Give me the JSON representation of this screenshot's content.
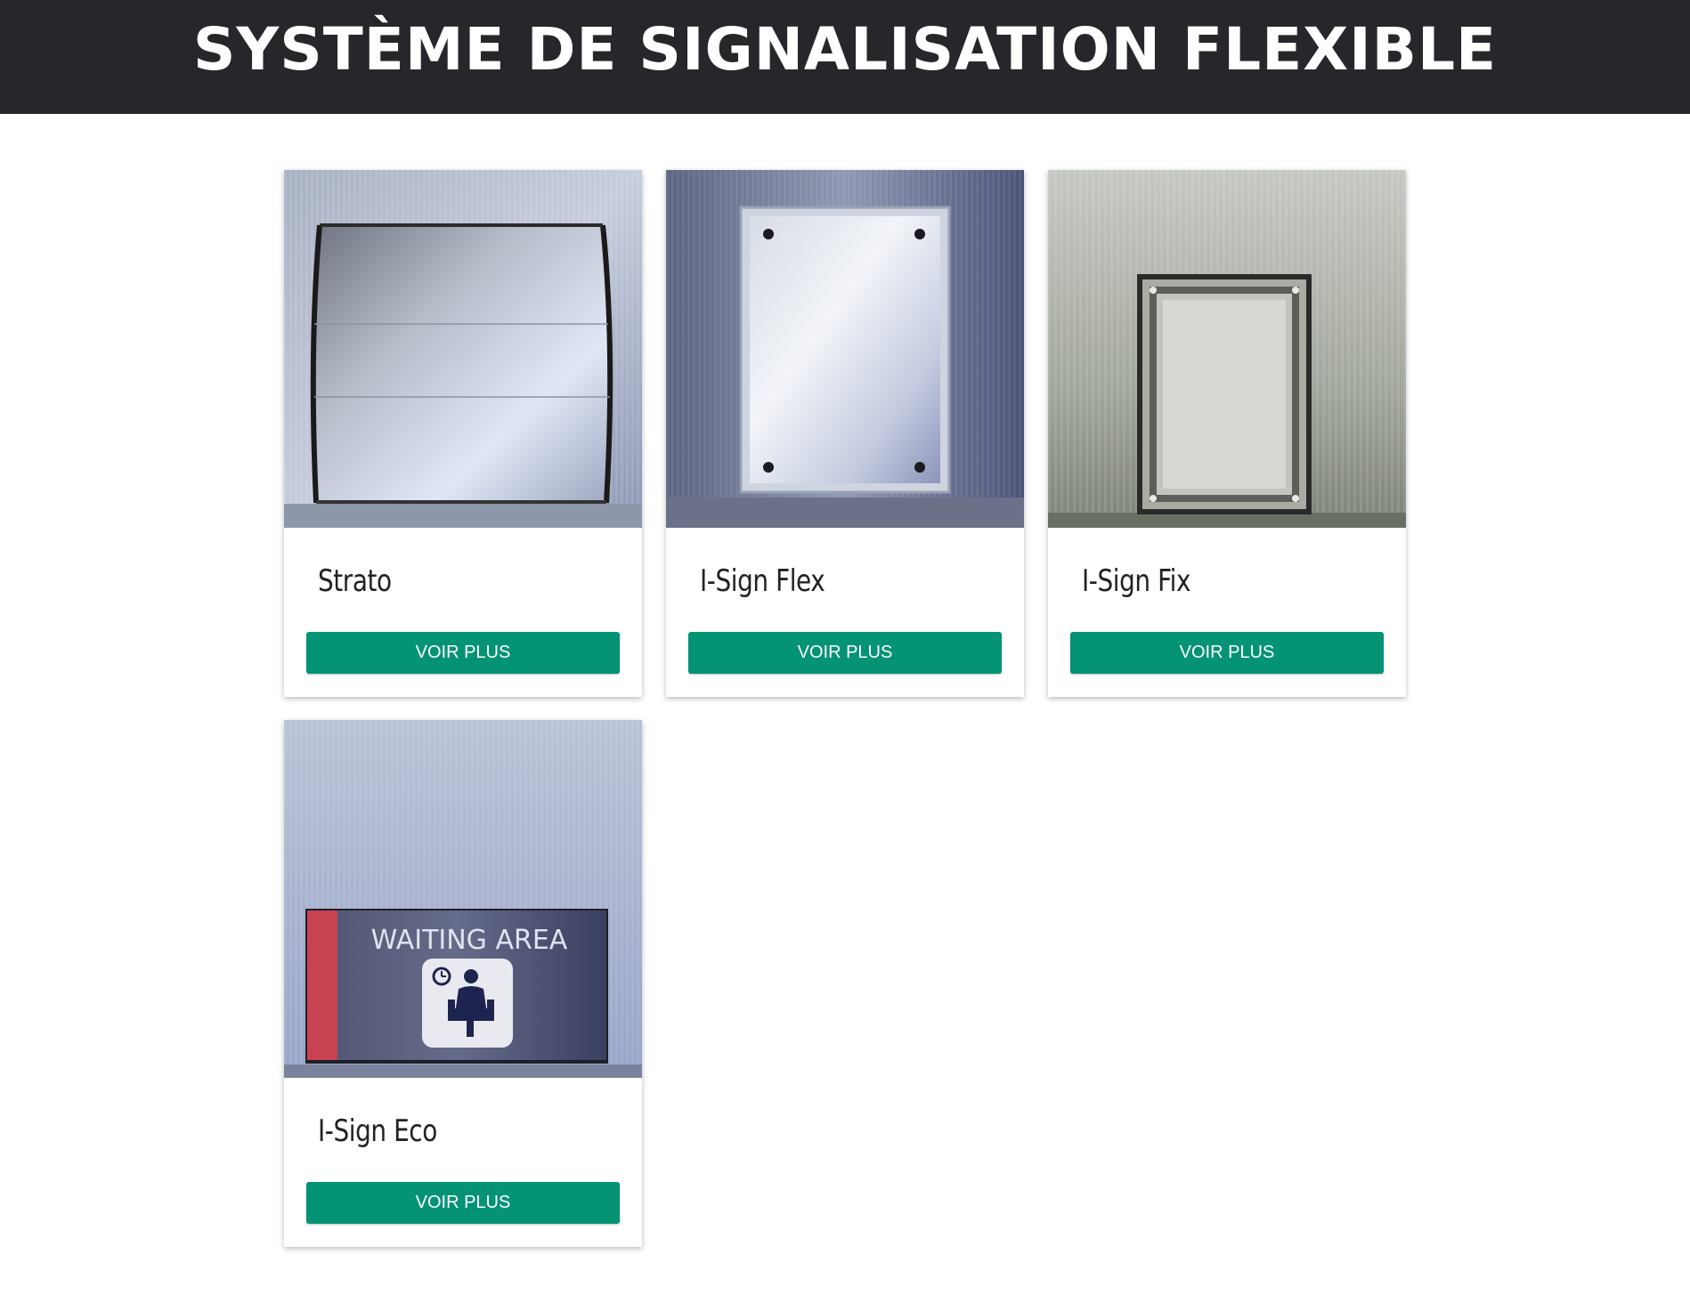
{
  "header": {
    "title": "SYSTÈME DE SIGNALISATION FLEXIBLE",
    "background": "#26272b"
  },
  "products": [
    {
      "name": "Strato",
      "button_label": "VOIR PLUS",
      "image_icon": "strato-sign-photo"
    },
    {
      "name": "I-Sign Flex",
      "button_label": "VOIR PLUS",
      "image_icon": "i-sign-flex-photo"
    },
    {
      "name": "I-Sign Fix",
      "button_label": "VOIR PLUS",
      "image_icon": "i-sign-fix-photo"
    },
    {
      "name": "I-Sign Eco",
      "button_label": "VOIR PLUS",
      "image_icon": "i-sign-eco-photo",
      "sign_text": "WAITING AREA"
    }
  ],
  "colors": {
    "button": "#049375",
    "button_text": "#ffffff"
  }
}
